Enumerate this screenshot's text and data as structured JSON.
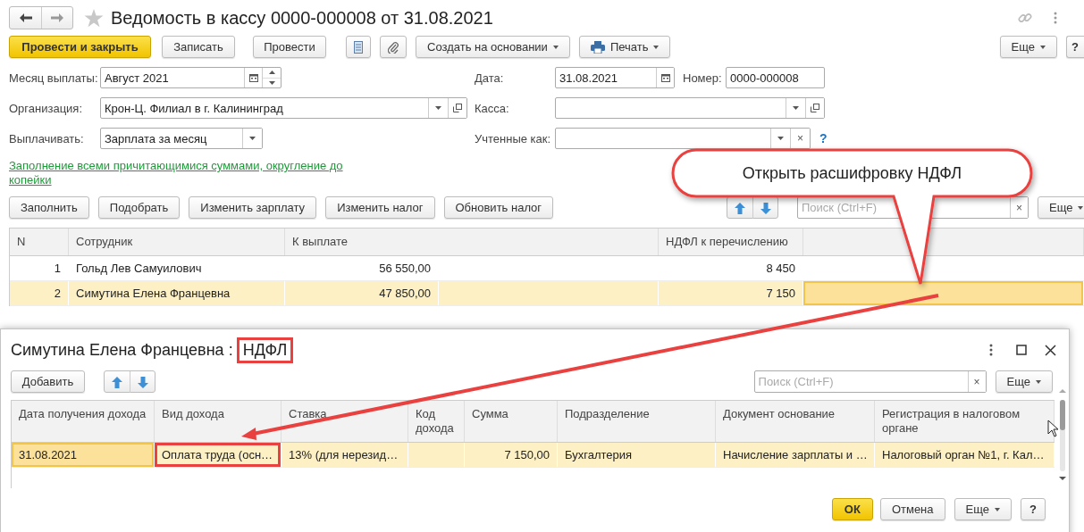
{
  "window": {
    "title": "Ведомость в кассу 0000-000008 от 31.08.2021"
  },
  "toolbar": {
    "primary": "Провести и закрыть",
    "buttons": [
      "Записать",
      "Провести"
    ],
    "menus": [
      "Создать на основании",
      "Печать"
    ],
    "more": "Еще",
    "help": "?"
  },
  "fields": [
    {
      "label": "Месяц выплаты:",
      "value": "Август 2021",
      "kind": "month"
    },
    {
      "label": "Организация:",
      "value": "Крон-Ц. Филиал в г. Калининград",
      "kind": "ref"
    },
    {
      "label": "Выплачивать:",
      "value": "Зарплата за месяц",
      "kind": "select"
    }
  ],
  "right_fields": [
    {
      "label": "Дата:",
      "value": "31.08.2021",
      "kind": "date",
      "extra": {
        "label": "Номер:",
        "value": "0000-000008"
      }
    },
    {
      "label": "Касса:",
      "kind": "ref"
    },
    {
      "label": "Учтенные как:",
      "kind": "clearable",
      "clear": "×",
      "help": "?"
    }
  ],
  "fill_link": "Заполнение всеми причитающимися суммами, округление до копейки",
  "table_toolbar": {
    "buttons": [
      "Заполнить",
      "Подобрать",
      "Изменить зарплату",
      "Изменить налог",
      "Обновить налог"
    ],
    "search": {
      "placeholder": "Поиск (Ctrl+F)"
    },
    "clear": "×",
    "more": "Еще"
  },
  "table": {
    "columns": [
      "N",
      "Сотрудник",
      "К выплате",
      "НДФЛ к перечислению"
    ],
    "rows": [
      {
        "selected": false,
        "cells": [
          {
            "text": "1"
          },
          {
            "text": "Гольд Лев Самуилович"
          },
          {
            "text": "56 550,00"
          },
          {},
          {
            "text": "8 450"
          },
          {
            "focused": false
          }
        ]
      },
      {
        "selected": true,
        "cells": [
          {
            "text": "2"
          },
          {
            "text": "Симутина Елена Францевна"
          },
          {
            "text": "47 850,00"
          },
          {},
          {
            "text": "7 150"
          },
          {
            "focused": true
          }
        ]
      }
    ]
  },
  "callout": {
    "text": "Открыть расшифровку НДФЛ"
  },
  "dialog": {
    "title": "Симутина Елена Францевна :",
    "title_highlight": "НДФЛ",
    "add": "Добавить",
    "search": {
      "placeholder": "Поиск (Ctrl+F)"
    },
    "clear": "×",
    "more": "Еще",
    "columns": [
      "Дата получения дохода",
      "Вид дохода",
      "Ставка",
      "Код дохода",
      "Сумма",
      "Подразделение",
      "Документ основание",
      "Регистрация в налоговом органе"
    ],
    "rows": [
      {
        "selected": true,
        "cells": [
          {
            "text": "31.08.2021",
            "focused": true
          },
          {
            "text": "Оплата труда (осн…",
            "highlighted": true
          },
          {
            "text": "13% (для нерезид…"
          },
          {},
          {
            "text": "7 150,00"
          },
          {
            "text": "Бухгалтерия"
          },
          {
            "text": "Начисление зарплаты и …"
          },
          {
            "text": "Налоговый орган №1, г. Кал…"
          }
        ]
      }
    ],
    "buttons": {
      "ok": "ОК",
      "cancel": "Отмена",
      "more": "Еще",
      "help": "?"
    }
  }
}
